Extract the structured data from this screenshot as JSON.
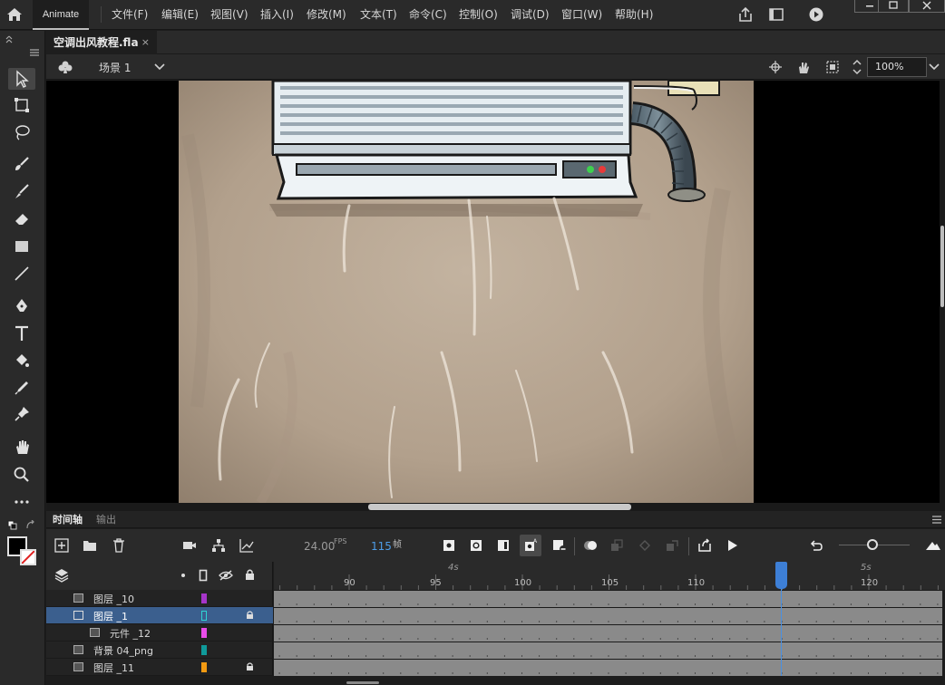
{
  "menubar": {
    "app_tab": "Animate",
    "menus": [
      "文件(F)",
      "编辑(E)",
      "视图(V)",
      "插入(I)",
      "修改(M)",
      "文本(T)",
      "命令(C)",
      "控制(O)",
      "调试(D)",
      "窗口(W)",
      "帮助(H)"
    ]
  },
  "document": {
    "tab_title": "空调出风教程.fla",
    "close_label": "×"
  },
  "scene": {
    "name": "场景 1",
    "zoom": "100%"
  },
  "timeline": {
    "tabs": [
      "时间轴",
      "输出"
    ],
    "fps_value": "24.00",
    "fps_label": "FPS",
    "current_frame": "115",
    "frame_label": "帧",
    "frame_numbers": [
      "90",
      "95",
      "100",
      "105",
      "110",
      "115",
      "120"
    ],
    "seconds_labels": [
      "4s",
      "5s"
    ],
    "layers": [
      {
        "name": "图层 _10",
        "color": "#a635c9",
        "locked": false,
        "selected": false,
        "indent": false
      },
      {
        "name": "图层 _1",
        "color": "#2fd4d4",
        "locked": true,
        "selected": true,
        "indent": false
      },
      {
        "name": "元件 _12",
        "color": "#e94de9",
        "locked": false,
        "selected": false,
        "indent": true
      },
      {
        "name": "背景 04_png",
        "color": "#0f9a9a",
        "locked": false,
        "selected": false,
        "indent": false
      },
      {
        "name": "图层 _11",
        "color": "#f29a12",
        "locked": true,
        "selected": false,
        "indent": false
      }
    ]
  },
  "icons": {
    "toolbar": [
      "select-icon",
      "free-transform-icon",
      "lasso-icon",
      "paint-brush-icon",
      "brush-icon",
      "eraser-icon",
      "rectangle-icon",
      "line-icon",
      "pen-icon",
      "text-icon",
      "paint-bucket-icon",
      "eyedropper-icon",
      "pin-icon",
      "hand-icon",
      "zoom-icon",
      "more-icon"
    ]
  }
}
